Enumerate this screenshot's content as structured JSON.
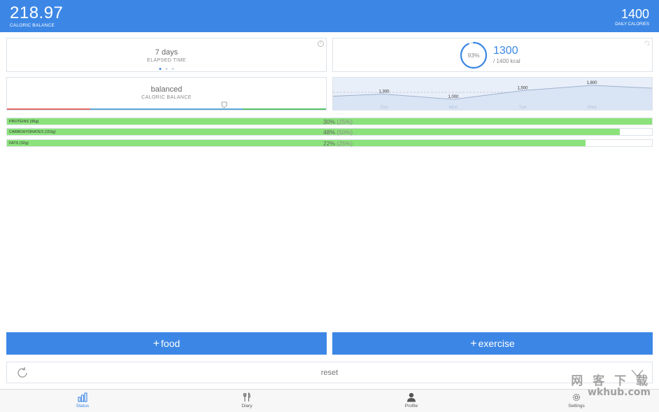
{
  "header": {
    "balance_value": "218.97",
    "balance_label": "CALORIC BALANCE",
    "daily_value": "1400",
    "daily_label": "DAILY CALORIES"
  },
  "elapsed": {
    "value": "7 days",
    "label": "ELAPSED TIME",
    "page_count": 3,
    "active_page": 1
  },
  "progress": {
    "percent_text": "93%",
    "percent": 93,
    "calories": "1300",
    "goal_text": "/ 1400 kcal"
  },
  "balance": {
    "value": "balanced",
    "label": "CALORIC BALANCE",
    "marker_position": 0.68
  },
  "chart_data": {
    "type": "line",
    "categories": [
      "Sun",
      "Mon",
      "Tue",
      "Wed"
    ],
    "series": [
      {
        "values": [
          1300,
          1000,
          1500,
          1800
        ]
      }
    ],
    "data_labels": [
      "1,300",
      "1,000",
      "1,500",
      "1,800"
    ],
    "baseline": 1400,
    "ylim": [
      800,
      2000
    ],
    "grid": false
  },
  "macros": [
    {
      "name": "PROTEINS (96g)",
      "percent": "30%",
      "target": "(25%)",
      "fill": 1.0
    },
    {
      "name": "CARBOHYDRATES (152g)",
      "percent": "48%",
      "target": "(50%)",
      "fill": 0.95
    },
    {
      "name": "FATS (32g)",
      "percent": "22%",
      "target": "(25%)",
      "fill": 0.897
    }
  ],
  "actions": {
    "food_label": "food",
    "exercise_label": "exercise",
    "reset_label": "reset"
  },
  "tabs": [
    {
      "label": "Status",
      "icon": "bar-chart-icon",
      "active": true
    },
    {
      "label": "Diary",
      "icon": "cutlery-icon",
      "active": false
    },
    {
      "label": "Profile",
      "icon": "person-icon",
      "active": false
    },
    {
      "label": "Settings",
      "icon": "gear-icon",
      "active": false
    }
  ],
  "watermark": {
    "line1": "网 客 下 载",
    "line2": "wkhub.com"
  },
  "colors": {
    "accent": "#3c87e6",
    "macro_fill": "#8be27a",
    "balance_red": "#e06a6a",
    "balance_blue": "#5aa9d6",
    "balance_green": "#56c26b"
  }
}
